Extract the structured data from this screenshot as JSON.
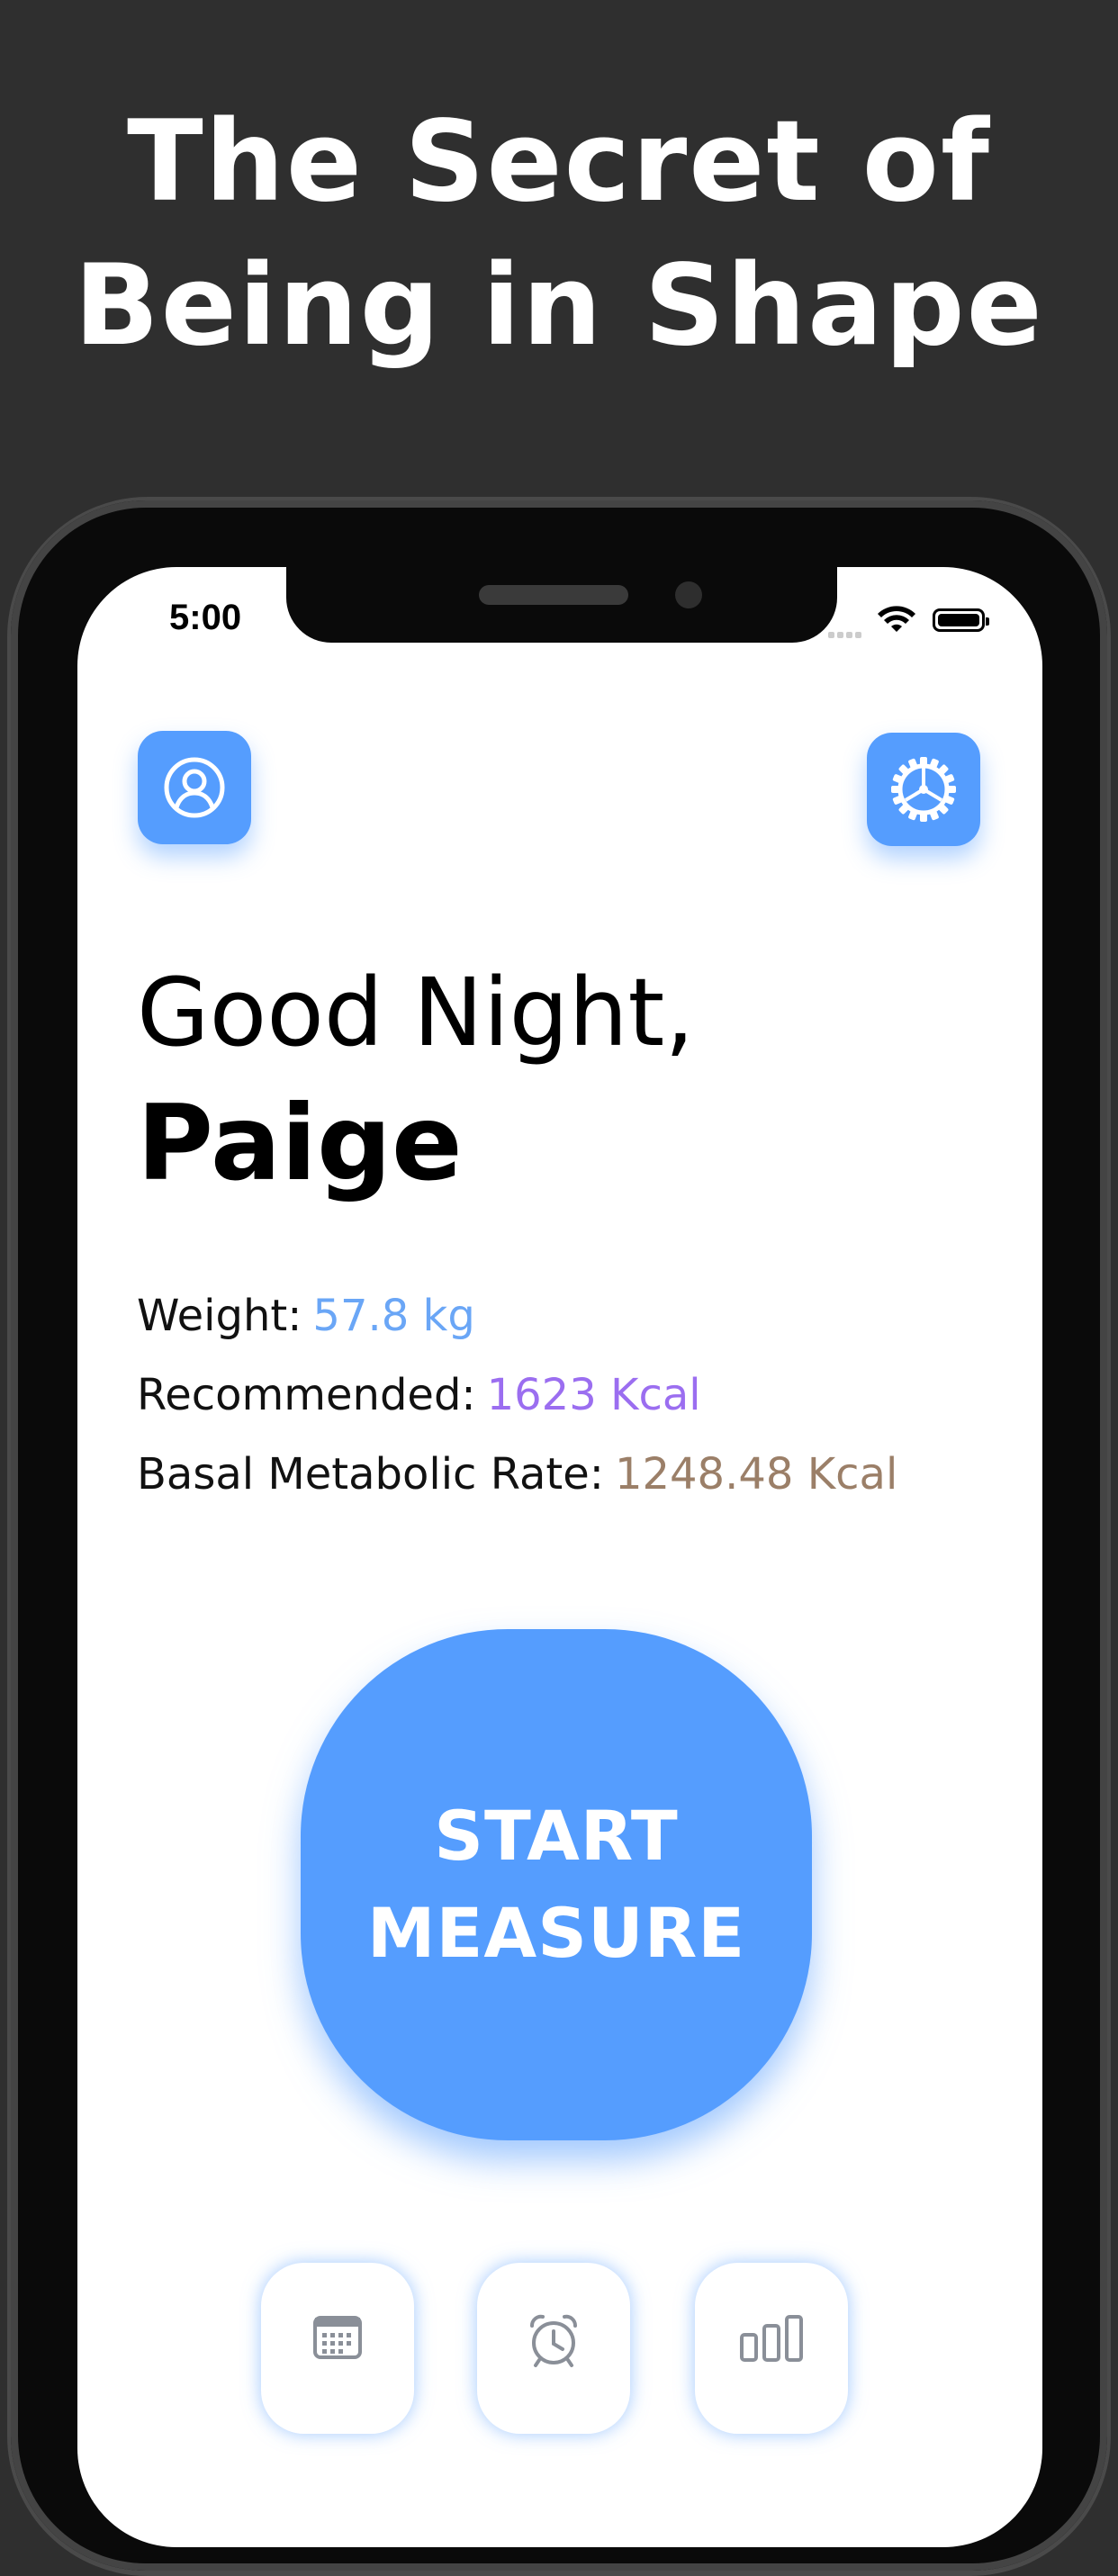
{
  "headline": {
    "line1": "The Secret of",
    "line2": "Being in Shape"
  },
  "status_bar": {
    "time": "5:00"
  },
  "top_buttons": {
    "profile_icon": "user-circle-icon",
    "settings_icon": "gear-icon"
  },
  "greeting": {
    "salutation": "Good Night,",
    "name": "Paige"
  },
  "stats": {
    "weight_label": "Weight:",
    "weight_value": "57.8 kg",
    "recommended_label": "Recommended:",
    "recommended_value": "1623 Kcal",
    "bmr_label": "Basal Metabolic Rate:",
    "bmr_value": "1248.48 Kcal"
  },
  "start_button": {
    "line1": "START",
    "line2": "MEASURE"
  },
  "tab_bar": {
    "items": [
      "calendar-icon",
      "alarm-clock-icon",
      "bar-chart-icon"
    ]
  },
  "colors": {
    "background": "#2f2f2f",
    "accent": "#559dfe",
    "weight_value": "#6aa6f6",
    "recommended_value": "#9b6ef0",
    "bmr_value": "#9b7f68",
    "icon_gray": "#8a8f98"
  }
}
